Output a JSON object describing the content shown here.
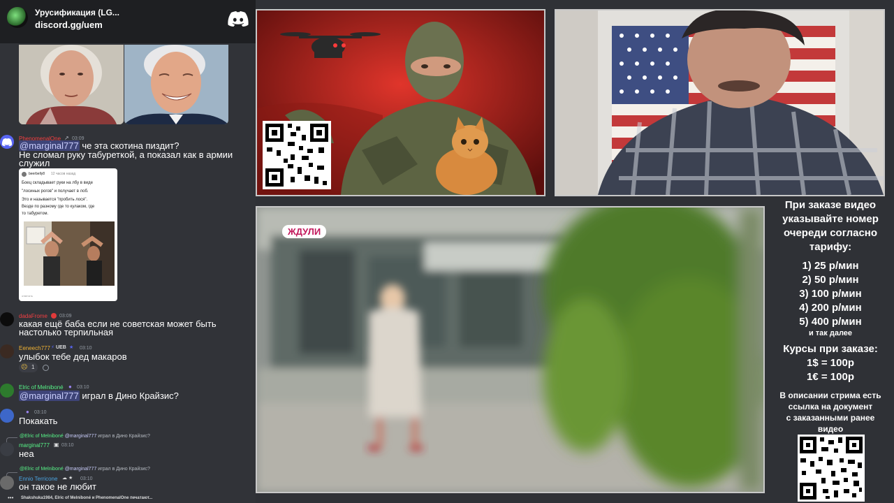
{
  "discord": {
    "server_name": "Урусификация (LG...",
    "server_invite": "discord.gg/uem",
    "messages": [
      {
        "username": "PhenomenalOne",
        "time": "03:09",
        "mention": "@marginal777",
        "text_after_mention": " че эта скотина пиздит?",
        "line2": "Не сломал руку табуреткой, а показал как в армии",
        "line3": "служил",
        "post": {
          "author": "beerbelly8",
          "posted": "12 часов назад",
          "text": [
            "Боец складывает руки на лбу в виде",
            "\"лосиных рогов\" и получает в лоб.",
            "Это и называется \"пробить лося\".",
            "Везде по разному где то кулаком, где",
            "то табуретом."
          ],
          "footer": "ответить"
        }
      },
      {
        "username": "dadaFrome",
        "time": "03:09",
        "line1": "какая ещё баба если не советская может быть",
        "line2": "настолько терпильная"
      },
      {
        "username": "Eeneech777",
        "tag": "UEB",
        "time": "03:10",
        "line1": "улыбок тебе дед макаров",
        "reaction_count": "1"
      },
      {
        "username": "Elric of Melniboné",
        "time": "03:10",
        "mention": "@marginal777",
        "text_after_mention": " играл в Дино Крайзис?"
      },
      {
        "time": "03:10",
        "line1": "Покакать"
      },
      {
        "reply_user": "@Elric of Melniboné",
        "reply_mention": "@marginal777",
        "reply_text": " играл в Дино Крайзис?",
        "username": "marginal777",
        "time": "03:10",
        "line1": "неа"
      },
      {
        "reply_user": "@Elric of Melniboné",
        "reply_mention": "@marginal777",
        "reply_text": " играл в Дино Крайзис?",
        "username": "Ennio Terricone",
        "time": "03:10",
        "line1": "он такое не любит"
      }
    ],
    "typing": "Shakshuka1984, Elric of Melniboné и PhenomenalOne печатают..."
  },
  "video_label": "ЖДУЛИ",
  "tariffs": {
    "heading": [
      "При заказе видео",
      "указывайте номер",
      "очереди согласно",
      "тарифу:"
    ],
    "items": [
      "1) 25 р/мин",
      "2) 50 р/мин",
      "3) 100 р/мин",
      "4) 200 р/мин",
      "5) 400 р/мин"
    ],
    "etc": "и так далее",
    "rates_title": "Курсы при заказе:",
    "rates": [
      "1$ = 100р",
      "1€ = 100р"
    ],
    "desc": [
      "В описании стрима есть",
      "ссылка на документ",
      "с заказанными ранее",
      "видео"
    ]
  },
  "colors": {
    "discord_bg": "#313338",
    "header_bg": "#1e1f22",
    "mention": "#c9cdfb",
    "accent_label": "#c2185b",
    "page_bg": "#2f3136"
  }
}
